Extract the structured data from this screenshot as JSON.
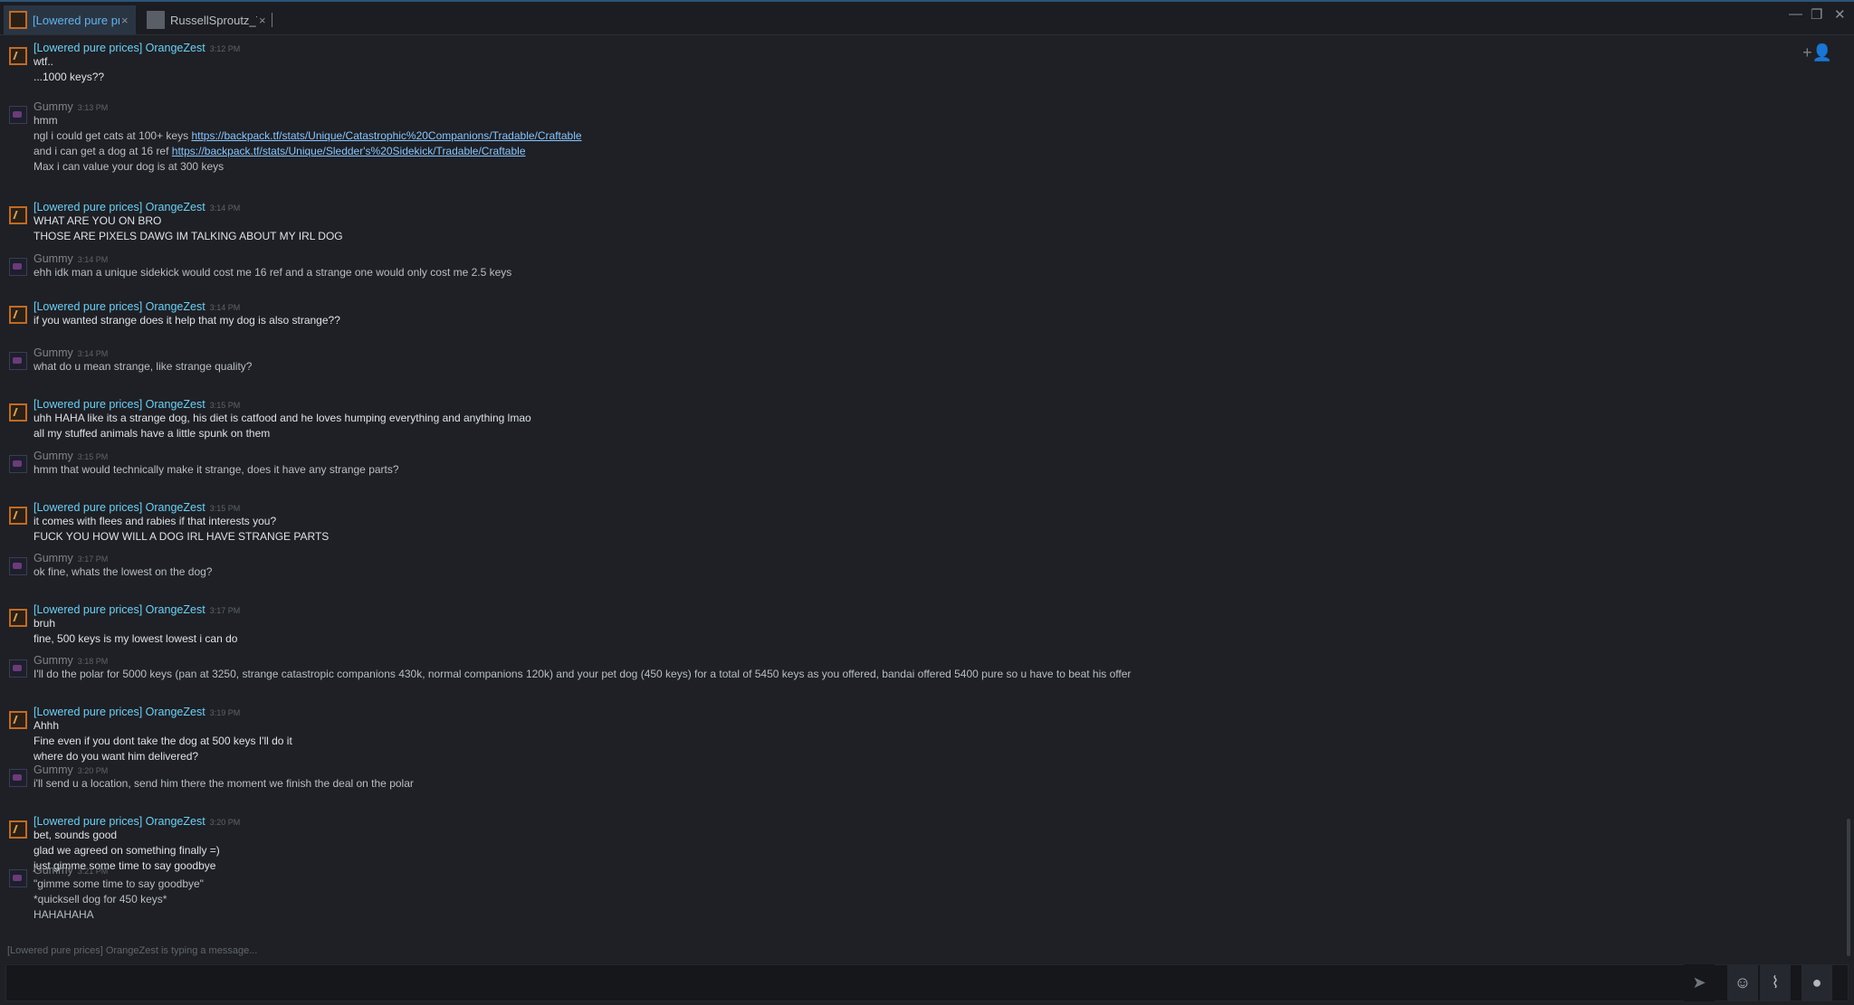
{
  "tabs": [
    {
      "label": "[Lowered pure prices] OrangeZest",
      "close": "×"
    },
    {
      "label": "RussellSproutz_YT",
      "close": "×"
    }
  ],
  "window_controls": {
    "minimize": "—",
    "maximize": "❐",
    "close": "✕"
  },
  "add_friend_icon": "+👤",
  "messages": [
    {
      "author": "[Lowered pure prices] OrangeZest",
      "time": "3:12 PM",
      "who": "oz",
      "lines": [
        "wtf..",
        "...1000 keys??"
      ]
    },
    {
      "author": "Gummy",
      "time": "3:13 PM",
      "who": "gm",
      "lines": [
        "hmm",
        {
          "text": "ngl i could get cats at 100+ keys ",
          "link": "https://backpack.tf/stats/Unique/Catastrophic%20Companions/Tradable/Craftable"
        },
        {
          "text": "and i can get a dog at 16 ref ",
          "link": "https://backpack.tf/stats/Unique/Sledder's%20Sidekick/Tradable/Craftable"
        },
        "Max i can value your dog is at 300 keys"
      ]
    },
    {
      "author": "[Lowered pure prices] OrangeZest",
      "time": "3:14 PM",
      "who": "oz",
      "lines": [
        "WHAT ARE YOU ON BRO",
        "THOSE ARE PIXELS DAWG IM TALKING ABOUT MY IRL DOG"
      ]
    },
    {
      "author": "Gummy",
      "time": "3:14 PM",
      "who": "gm",
      "lines": [
        "ehh idk man a unique sidekick would cost me 16 ref and a strange one would only cost me 2.5 keys"
      ]
    },
    {
      "author": "[Lowered pure prices] OrangeZest",
      "time": "3:14 PM",
      "who": "oz",
      "lines": [
        "if you wanted strange does it help that my dog is also strange??"
      ]
    },
    {
      "author": "Gummy",
      "time": "3:14 PM",
      "who": "gm",
      "lines": [
        "what do u mean strange, like strange quality?"
      ]
    },
    {
      "author": "[Lowered pure prices] OrangeZest",
      "time": "3:15 PM",
      "who": "oz",
      "lines": [
        "uhh HAHA like its a strange dog, his diet is catfood and he loves humping everything and anything lmao",
        "all my stuffed animals have a little spunk on them"
      ]
    },
    {
      "author": "Gummy",
      "time": "3:15 PM",
      "who": "gm",
      "lines": [
        "hmm that would technically make it strange, does it have any strange parts?"
      ]
    },
    {
      "author": "[Lowered pure prices] OrangeZest",
      "time": "3:15 PM",
      "who": "oz",
      "lines": [
        "it comes with flees and rabies if that interests you?",
        "FUCK YOU HOW WILL A DOG IRL HAVE STRANGE PARTS"
      ]
    },
    {
      "author": "Gummy",
      "time": "3:17 PM",
      "who": "gm",
      "lines": [
        "ok fine, whats the lowest on the dog?"
      ]
    },
    {
      "author": "[Lowered pure prices] OrangeZest",
      "time": "3:17 PM",
      "who": "oz",
      "lines": [
        "bruh",
        "fine, 500 keys is my lowest lowest i can do"
      ]
    },
    {
      "author": "Gummy",
      "time": "3:18 PM",
      "who": "gm",
      "lines": [
        "I'll do the polar for 5000 keys (pan at 3250, strange catastropic companions 430k, normal companions 120k) and your pet dog (450 keys) for a total of 5450 keys as you offered, bandai offered 5400 pure so u have to beat his offer"
      ]
    },
    {
      "author": "[Lowered pure prices] OrangeZest",
      "time": "3:19 PM",
      "who": "oz",
      "lines": [
        "Ahhh",
        "Fine even if you dont take the dog at 500 keys I'll do it",
        "where do you want him delivered?"
      ]
    },
    {
      "author": "Gummy",
      "time": "3:20 PM",
      "who": "gm",
      "lines": [
        "i'll send u a location, send him there the moment we finish the deal on the polar"
      ]
    },
    {
      "author": "[Lowered pure prices] OrangeZest",
      "time": "3:20 PM",
      "who": "oz",
      "lines": [
        "bet, sounds good",
        "glad we agreed on something finally =)",
        "just gimme some time to say goodbye"
      ]
    },
    {
      "author": "Gummy",
      "time": "3:21 PM",
      "who": "gm",
      "lines": [
        "\"gimme some time to say goodbye\"",
        "*quicksell dog for 450 keys*",
        "HAHAHAHA"
      ]
    }
  ],
  "typing_indicator": "[Lowered pure prices] OrangeZest is typing a message...",
  "composer": {
    "placeholder": ""
  },
  "composer_icons": [
    "send-icon",
    "emoticon-icon",
    "attachment-icon",
    "voice-icon"
  ]
}
